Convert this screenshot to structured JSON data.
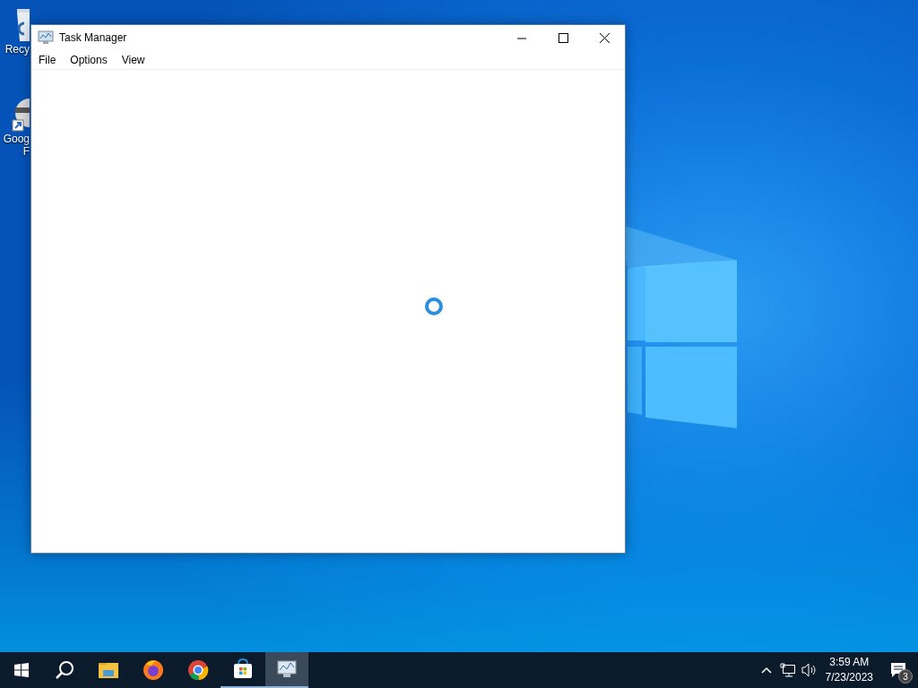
{
  "desktop_icons": [
    {
      "kind": "recycle-bin",
      "label_lines": [
        "Recy"
      ]
    },
    {
      "kind": "shortcut",
      "label_lines": [
        "Goog",
        "F"
      ]
    }
  ],
  "window": {
    "title": "Task Manager",
    "menu": [
      "File",
      "Options",
      "View"
    ],
    "loading": true
  },
  "taskbar": {
    "apps": [
      {
        "kind": "files",
        "running": false,
        "selected": false
      },
      {
        "kind": "firefox",
        "running": false,
        "selected": false
      },
      {
        "kind": "chrome",
        "running": false,
        "selected": false
      },
      {
        "kind": "store",
        "running": true,
        "selected": false
      },
      {
        "kind": "taskmgr",
        "running": true,
        "selected": true
      }
    ]
  },
  "tray": {
    "time": "3:59 AM",
    "date": "7/23/2023",
    "notifications": "3"
  }
}
